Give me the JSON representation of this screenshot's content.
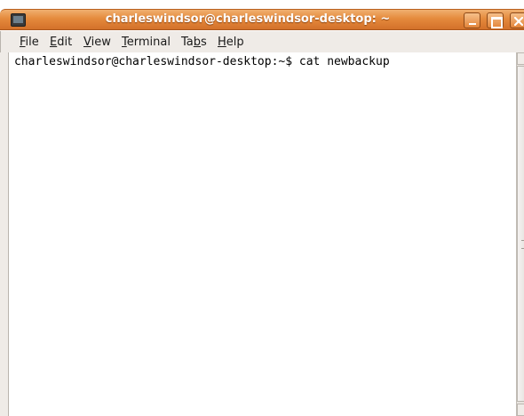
{
  "window": {
    "title": "charleswindsor@charleswindsor-desktop: ~"
  },
  "menu": {
    "items": [
      {
        "pre": "",
        "key": "F",
        "post": "ile"
      },
      {
        "pre": "",
        "key": "E",
        "post": "dit"
      },
      {
        "pre": "",
        "key": "V",
        "post": "iew"
      },
      {
        "pre": "",
        "key": "T",
        "post": "erminal"
      },
      {
        "pre": "Ta",
        "key": "b",
        "post": "s"
      },
      {
        "pre": "",
        "key": "H",
        "post": "elp"
      }
    ]
  },
  "terminal": {
    "prompt": "charleswindsor@charleswindsor-desktop:~$ cat newbackup"
  },
  "colors": {
    "titlebar": "#e58a3c",
    "menubar": "#efebe7",
    "terminal_bg": "#ffffff"
  },
  "icons": {
    "window_icon": "terminal-icon",
    "minimize": "minimize-icon",
    "maximize": "maximize-icon",
    "close": "close-icon"
  }
}
